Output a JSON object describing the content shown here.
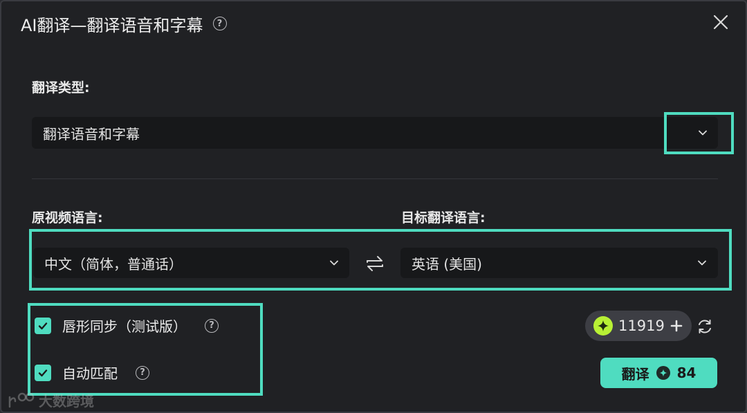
{
  "dialog": {
    "title": "AI翻译—翻译语音和字幕"
  },
  "translation_type": {
    "label": "翻译类型:",
    "selected": "翻译语音和字幕"
  },
  "source_language": {
    "label": "原视频语言:",
    "selected": "中文（简体，普通话）"
  },
  "target_language": {
    "label": "目标翻译语言:",
    "selected": "英语 (美国)"
  },
  "options": {
    "lip_sync": {
      "label": "唇形同步（测试版）",
      "checked": true
    },
    "auto_match": {
      "label": "自动匹配",
      "checked": true
    }
  },
  "credits": {
    "balance": "11919"
  },
  "translate_button": {
    "label": "翻译",
    "cost": "84"
  },
  "watermark": {
    "text": "大数跨境"
  },
  "colors": {
    "accent": "#4fdcc0",
    "background": "#202124",
    "field": "#17181a",
    "gem": "#b8f035"
  },
  "icons": {
    "help": "help-circle-icon",
    "close": "close-icon",
    "chevron": "chevron-down-icon",
    "swap": "swap-arrows-icon",
    "check": "check-icon",
    "gem": "sparkle-gem-icon",
    "plus": "plus-icon",
    "refresh": "refresh-icon",
    "coin": "coin-icon"
  }
}
